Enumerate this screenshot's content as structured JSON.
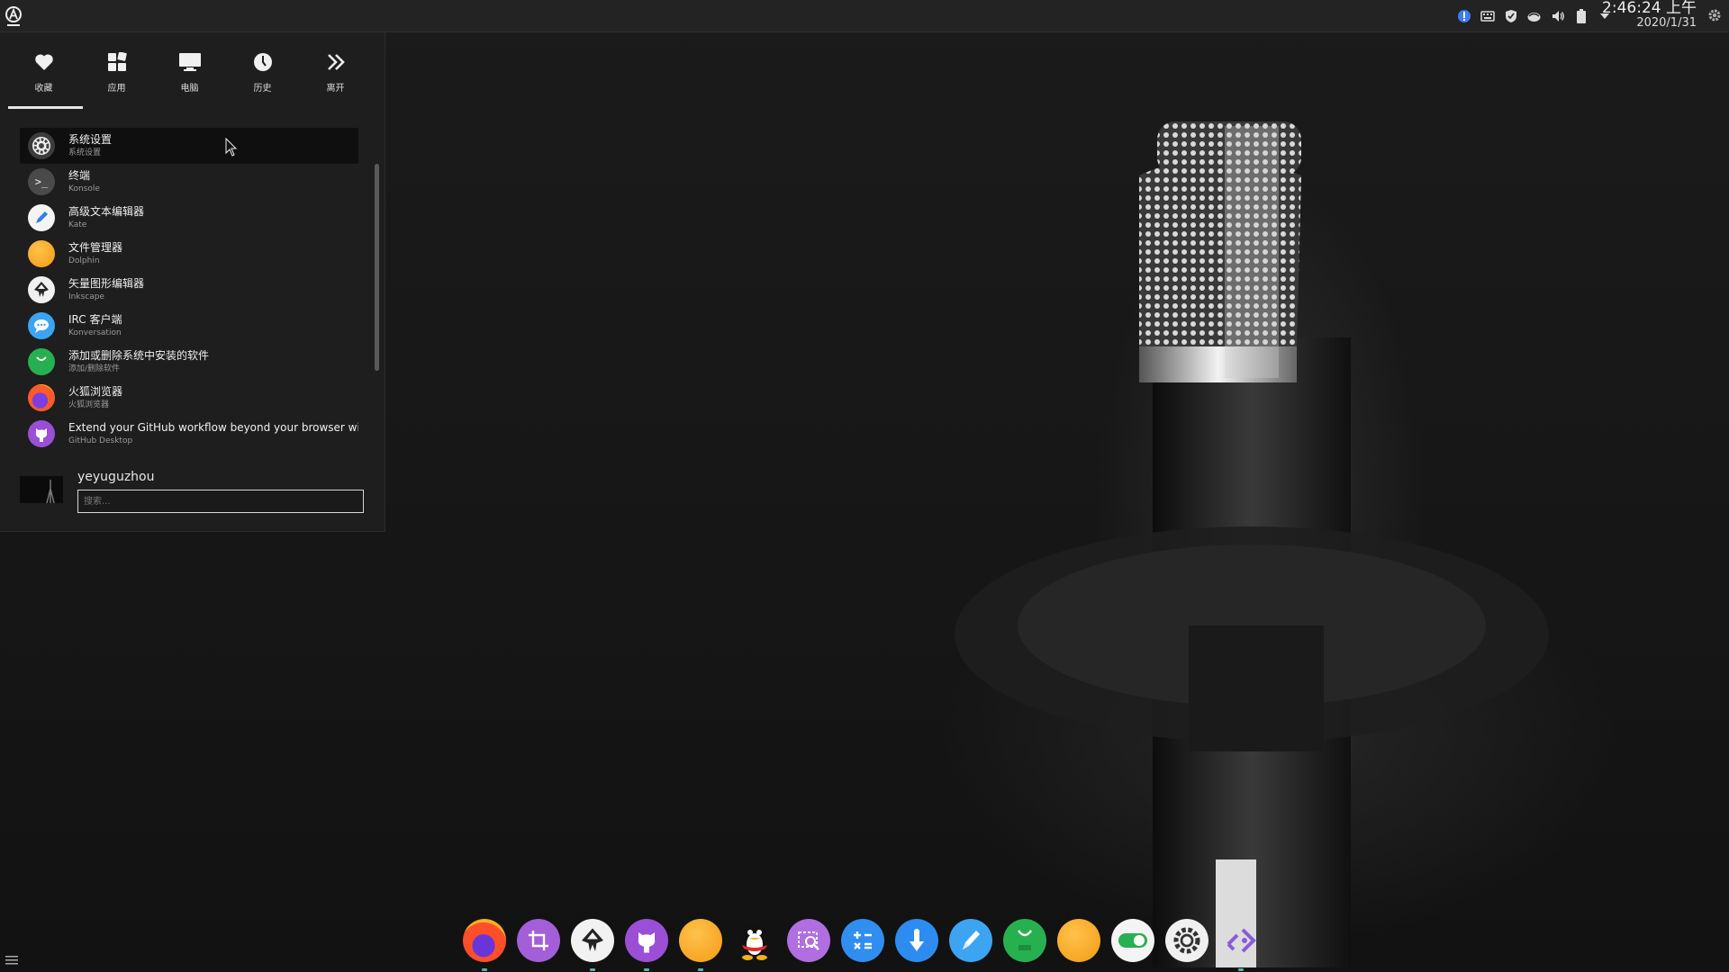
{
  "menu": {
    "tabs": [
      {
        "label": "收藏",
        "icon": "heart-icon"
      },
      {
        "label": "应用",
        "icon": "grid-icon"
      },
      {
        "label": "电脑",
        "icon": "monitor-icon"
      },
      {
        "label": "历史",
        "icon": "clock-icon"
      },
      {
        "label": "离开",
        "icon": "double-chevron-right-icon"
      }
    ],
    "active_tab": "收藏",
    "items": [
      {
        "title": "系统设置",
        "subtitle": "系统设置",
        "icon": "gear-icon",
        "color": "#3c3c3c"
      },
      {
        "title": "终端",
        "subtitle": "Konsole",
        "icon": "terminal-icon",
        "color": "#4a4a4a"
      },
      {
        "title": "高级文本编辑器",
        "subtitle": "Kate",
        "icon": "pen-icon",
        "color": "#f4f4f4"
      },
      {
        "title": "文件管理器",
        "subtitle": "Dolphin",
        "icon": "folder-icon",
        "color": "#f6a21f"
      },
      {
        "title": "矢量图形编辑器",
        "subtitle": "Inkscape",
        "icon": "inkscape-icon",
        "color": "#f0f0f0"
      },
      {
        "title": "IRC 客户端",
        "subtitle": "Konversation",
        "icon": "chat-icon",
        "color": "#3da4f2"
      },
      {
        "title": "添加或删除系统中安装的软件",
        "subtitle": "添加/删除软件",
        "icon": "software-icon",
        "color": "#27b04f"
      },
      {
        "title": "火狐浏览器",
        "subtitle": "火狐浏览器",
        "icon": "firefox-icon",
        "color": "#ff7a1a"
      },
      {
        "title": "Extend your GitHub workflow beyond your browser wi...",
        "subtitle": "GitHub Desktop",
        "icon": "github-icon",
        "color": "#9b4fd6"
      }
    ],
    "user": {
      "name": "yeyuguzhou"
    },
    "search": {
      "placeholder": "搜索..."
    }
  },
  "panel": {
    "clock_time": "2:46:24 上午",
    "clock_date": "2020/1/31",
    "tray_icons": [
      "info-icon",
      "keyboard-icon",
      "shield-icon",
      "network-icon",
      "volume-icon",
      "battery-icon",
      "expand-arrow-icon"
    ]
  },
  "dock": {
    "apps": [
      {
        "name": "firefox",
        "icon": "firefox-icon",
        "color": "#ff7a1a",
        "running": true
      },
      {
        "name": "crop",
        "icon": "crop-icon",
        "color": "#a35fd8",
        "running": false
      },
      {
        "name": "inkscape",
        "icon": "inkscape-icon",
        "color": "#f2f2f2",
        "running": true
      },
      {
        "name": "github",
        "icon": "github-icon",
        "color": "#9b4fd6",
        "running": true
      },
      {
        "name": "dolphin",
        "icon": "folder-icon",
        "color": "#f6a21f",
        "running": true
      },
      {
        "name": "qq",
        "icon": "penguin-icon",
        "color": "#111111",
        "running": false
      },
      {
        "name": "screenshot",
        "icon": "screenshot-icon",
        "color": "#b06ee0",
        "running": false
      },
      {
        "name": "calculator",
        "icon": "calculator-icon",
        "color": "#2f8ef0",
        "running": false
      },
      {
        "name": "downloader",
        "icon": "download-icon",
        "color": "#2d8cf0",
        "running": false
      },
      {
        "name": "kate",
        "icon": "pen-icon",
        "color": "#3da4f2",
        "running": false
      },
      {
        "name": "software",
        "icon": "software-icon",
        "color": "#27b04f",
        "running": false
      },
      {
        "name": "files",
        "icon": "folder-icon",
        "color": "#f6a21f",
        "running": false
      },
      {
        "name": "toggle",
        "icon": "toggle-icon",
        "color": "#f4f4f4",
        "running": false
      },
      {
        "name": "settings",
        "icon": "gear-icon",
        "color": "#f0f0f0",
        "running": false
      },
      {
        "name": "visual-studio-code",
        "icon": "code-icon",
        "color": "#8a5bd6",
        "running": true
      }
    ]
  }
}
